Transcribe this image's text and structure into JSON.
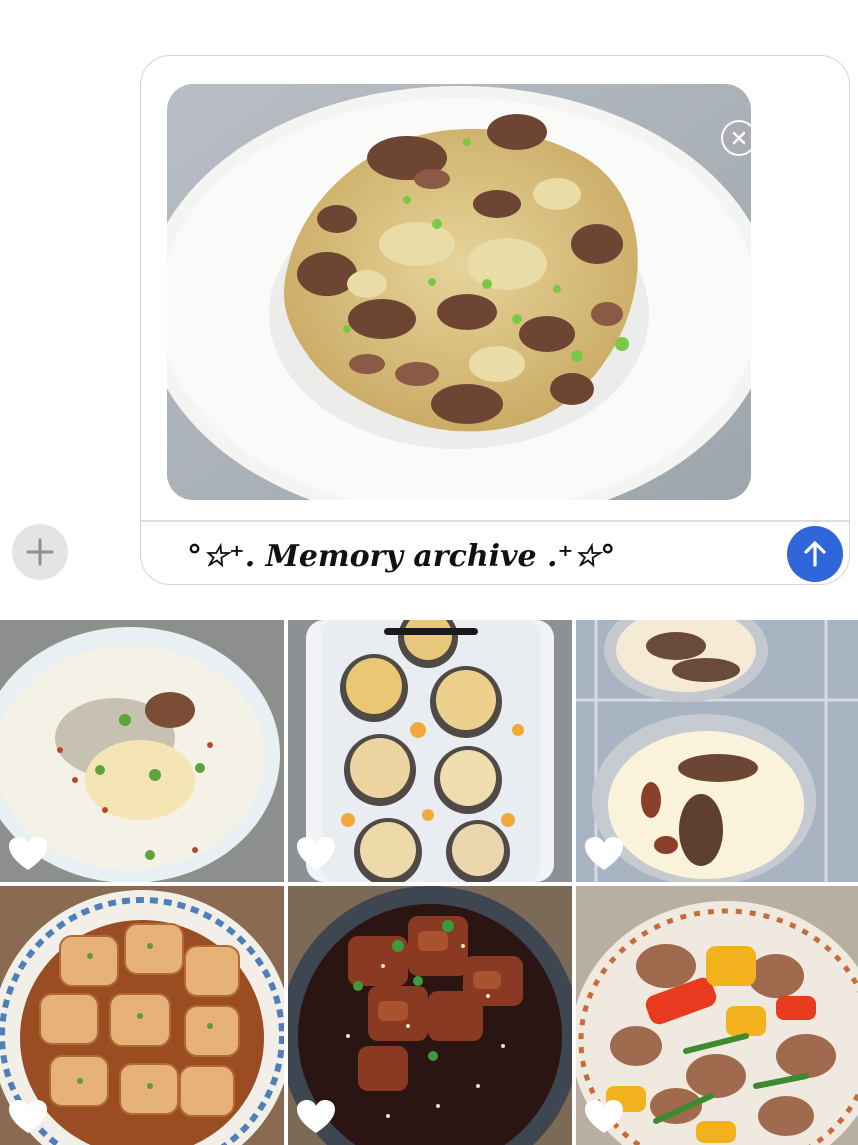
{
  "composer": {
    "message_text": "°☆⁺. Memory archive .⁺☆°",
    "attachment_icon": "close-icon",
    "send_icon": "arrow-up-icon",
    "add_icon": "plus-icon",
    "accent_color": "#2f66d9"
  },
  "photo_grid": {
    "heart_icon": "heart-icon",
    "tiles": [
      {
        "name": "fish-soup-photo"
      },
      {
        "name": "stuffed-mushroom-photo"
      },
      {
        "name": "steamed-egg-morel-photo"
      },
      {
        "name": "tofu-plate-photo"
      },
      {
        "name": "glazed-beef-photo"
      },
      {
        "name": "pepper-stirfry-photo"
      }
    ]
  }
}
